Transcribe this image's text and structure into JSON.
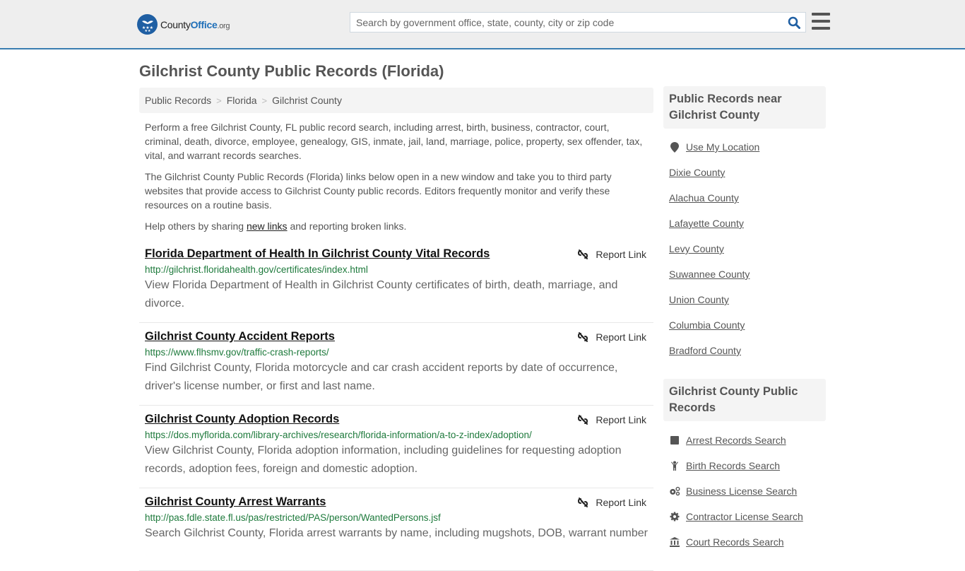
{
  "header": {
    "logo": {
      "county": "County",
      "office": "Office",
      "org": ".org"
    },
    "search": {
      "placeholder": "Search by government office, state, county, city or zip code",
      "value": ""
    },
    "colors": {
      "brand": "#1f5fa3",
      "accent_border": "#3a7db0"
    }
  },
  "page": {
    "title": "Gilchrist County Public Records (Florida)",
    "breadcrumb": [
      "Public Records",
      "Florida",
      "Gilchrist County"
    ],
    "intro": {
      "p1": "Perform a free Gilchrist County, FL public record search, including arrest, birth, business, contractor, court, criminal, death, divorce, employee, genealogy, GIS, inmate, jail, land, marriage, police, property, sex offender, tax, vital, and warrant records searches.",
      "p2": "The Gilchrist County Public Records (Florida) links below open in a new window and take you to third party websites that provide access to Gilchrist County public records. Editors frequently monitor and verify these resources on a routine basis.",
      "p3_before": "Help others by sharing ",
      "p3_link": "new links",
      "p3_after": " and reporting broken links."
    },
    "report_label": "Report Link",
    "records": [
      {
        "title": "Florida Department of Health In Gilchrist County Vital Records",
        "url": "http://gilchrist.floridahealth.gov/certificates/index.html",
        "description": "View Florida Department of Health in Gilchrist County certificates of birth, death, marriage, and divorce."
      },
      {
        "title": "Gilchrist County Accident Reports",
        "url": "https://www.flhsmv.gov/traffic-crash-reports/",
        "description": "Find Gilchrist County, Florida motorcycle and car crash accident reports by date of occurrence, driver's license number, or first and last name."
      },
      {
        "title": "Gilchrist County Adoption Records",
        "url": "https://dos.myflorida.com/library-archives/research/florida-information/a-to-z-index/adoption/",
        "description": "View Gilchrist County, Florida adoption information, including guidelines for requesting adoption records, adoption fees, foreign and domestic adoption."
      },
      {
        "title": "Gilchrist County Arrest Warrants",
        "url": "http://pas.fdle.state.fl.us/pas/restricted/PAS/person/WantedPersons.jsf",
        "description": "Search Gilchrist County, Florida arrest warrants by name, including mugshots, DOB, warrant number"
      }
    ]
  },
  "sidebar": {
    "nearby": {
      "title": "Public Records near Gilchrist County",
      "use_location": "Use My Location",
      "counties": [
        "Dixie County",
        "Alachua County",
        "Lafayette County",
        "Levy County",
        "Suwannee County",
        "Union County",
        "Columbia County",
        "Bradford County"
      ]
    },
    "county_records": {
      "title": "Gilchrist County Public Records",
      "items": [
        {
          "label": "Arrest Records Search",
          "icon": "square-icon"
        },
        {
          "label": "Birth Records Search",
          "icon": "child-icon"
        },
        {
          "label": "Business License Search",
          "icon": "cogs-icon"
        },
        {
          "label": "Contractor License Search",
          "icon": "gear-icon"
        },
        {
          "label": "Court Records Search",
          "icon": "courthouse-icon"
        }
      ]
    }
  }
}
